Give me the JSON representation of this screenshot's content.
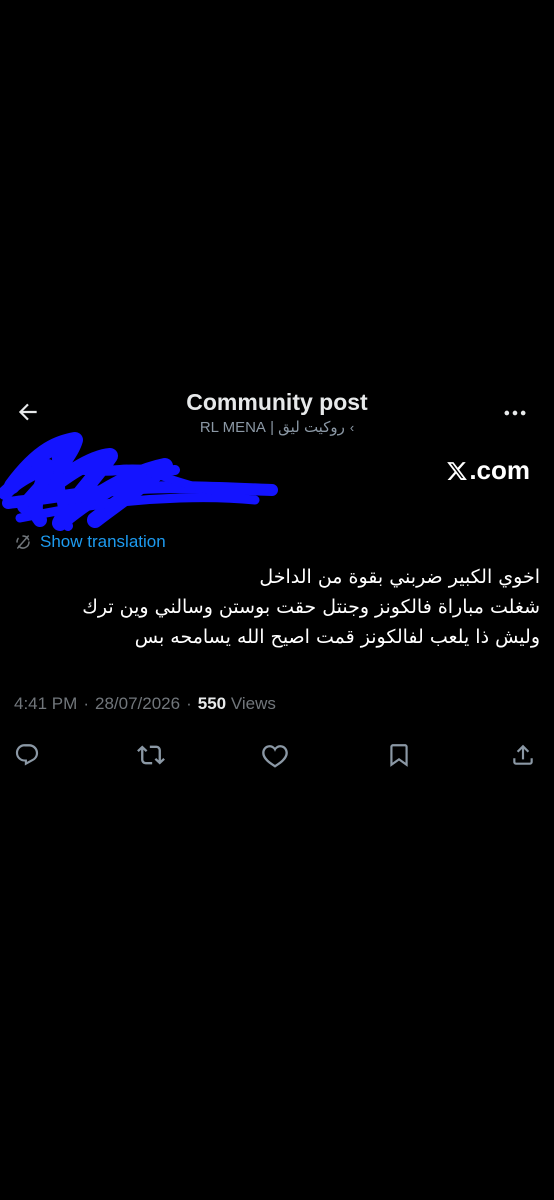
{
  "header": {
    "back_icon": "arrow-left-icon",
    "title": "Community post",
    "community_name": "روكيت ليق | RL MENA",
    "community_chevron": "‹",
    "more_icon": "more-horizontal-icon"
  },
  "post": {
    "author_redacted": true,
    "redaction_color": "#1414ff",
    "watermark": ".com",
    "watermark_logo": "x-logo-icon",
    "translate_label": "Show translation",
    "text_lines": [
      "اخوي الكبير ضربني بقوة من الداخل",
      "شغلت مباراة فالكونز وجنتل حقت بوستن وسالني وين ترك",
      "وليش ذا يلعب لفالكونز قمت اصيح الله يسامحه بس"
    ],
    "time": "4:41 PM",
    "separator": "·",
    "date": "28/07/2026",
    "views_count": "550",
    "views_label": "Views"
  },
  "actions": [
    {
      "name": "reply",
      "icon": "reply-icon"
    },
    {
      "name": "repost",
      "icon": "repost-icon"
    },
    {
      "name": "like",
      "icon": "heart-icon"
    },
    {
      "name": "bookmark",
      "icon": "bookmark-icon"
    },
    {
      "name": "share",
      "icon": "share-icon"
    }
  ],
  "colors": {
    "background": "#000000",
    "text_primary": "#e7e9ea",
    "text_secondary": "#71767b",
    "link": "#1d9bf0"
  }
}
